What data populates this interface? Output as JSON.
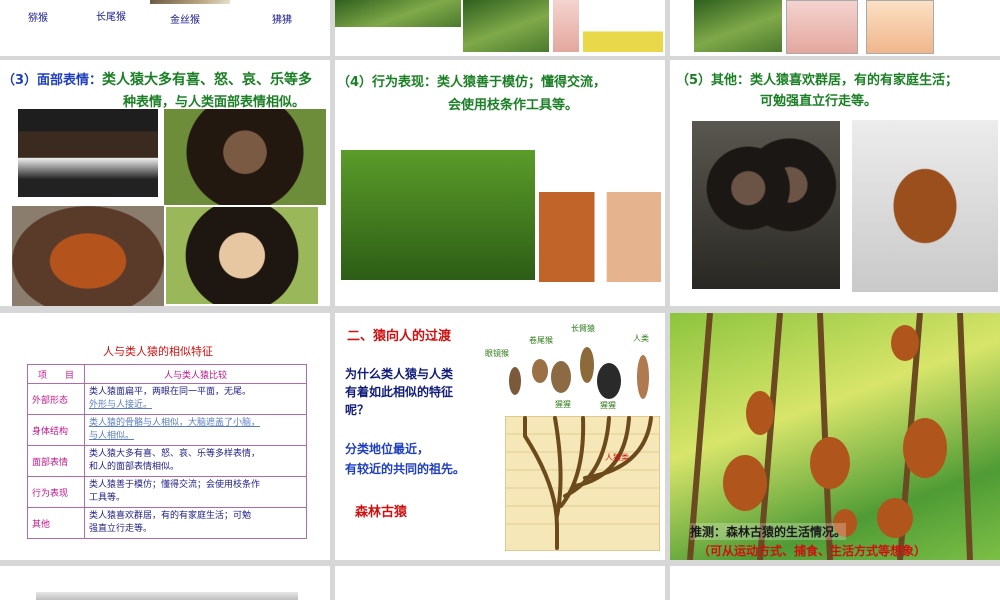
{
  "row1": {
    "labels": [
      "猕猴",
      "长尾猴",
      "金丝猴",
      "狒狒"
    ]
  },
  "slide_face": {
    "heading_prefix": "（3）面部表情：",
    "heading_text": "类人猿大多有喜、怒、哀、乐等多",
    "heading_line2": "种表情，与人类面部表情相似。"
  },
  "slide_behavior": {
    "heading_line1": "（4）行为表现：类人猿善于模仿；懂得交流，",
    "heading_line2": "会使用枝条作工具等。"
  },
  "slide_other": {
    "heading_line1": "（5）其他：类人猿喜欢群居，有的有家庭生活；",
    "heading_line2": "可勉强直立行走等。"
  },
  "slide_table": {
    "title": "人与类人猿的相似特征",
    "col_item": "项　　目",
    "col_compare": "人与类人猿比较",
    "rows": [
      {
        "key": "外部形态",
        "l1": "类人猿面扁平，两眼在同一平面，无尾。",
        "l2": "外形与人接近。"
      },
      {
        "key": "身体结构",
        "l1": "类人猿的骨骼与人相似，大脑遮盖了小脑，",
        "l2": "与人相似。"
      },
      {
        "key": "面部表情",
        "l1": "类人猿大多有喜、怒、哀、乐等多样表情，",
        "l2": "和人的面部表情相似。"
      },
      {
        "key": "行为表现",
        "l1": "类人猿善于模仿；懂得交流；会使用枝条作",
        "l2": "工具等。"
      },
      {
        "key": "其他",
        "l1": "类人猿喜欢群居，有的有家庭生活；可勉",
        "l2": "强直立行走等。"
      }
    ]
  },
  "slide_transition": {
    "heading": "二、猿向人的过渡",
    "question_l1": "为什么类人猿与人类",
    "question_l2": "有着如此相似的特征",
    "question_l3": "呢？",
    "answer_l1": "分类地位最近，",
    "answer_l2": "有较近的共同的祖先。",
    "ancestor": "森林古猿",
    "species": {
      "lemur": "眼镜猴",
      "wukong": "卷尾猴",
      "gibbon": "长臂猿",
      "human": "人类",
      "orangutan": "猩猩",
      "gorilla": "猩猩"
    },
    "tree_label": "人猿类"
  },
  "slide_forest": {
    "caption_l1": "推测：森林古猿的生活情况。",
    "caption_l2": "（可从运动方式、捕食、生活方式等想象）",
    "caption_color": "#d01010"
  },
  "colors": {
    "blue": "#1f3fbf",
    "green": "#1b7f25",
    "red": "#d01010",
    "magenta": "#c0178a"
  }
}
